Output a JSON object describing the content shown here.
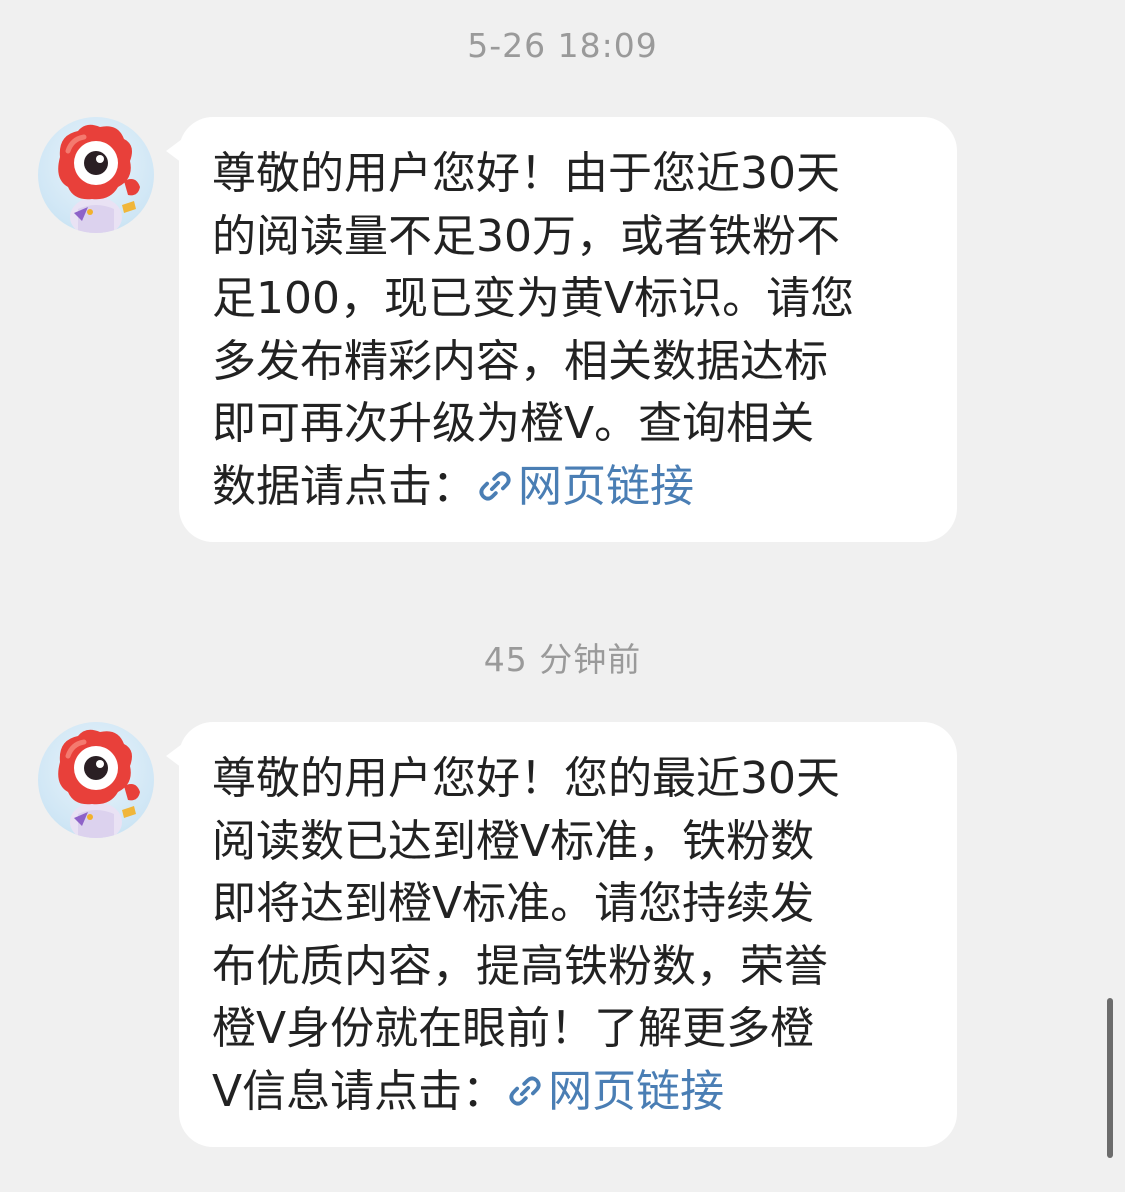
{
  "messages": [
    {
      "timestamp": "5-26 18:09",
      "text": "尊敬的用户您好！由于您近30天\n的阅读量不足30万，或者铁粉不\n足100，现已变为黄V标识。请您\n多发布精彩内容，相关数据达标\n即可再次升级为橙V。查询相关\n数据请点击：",
      "link_label": "网页链接",
      "link_icon": "link-icon",
      "avatar_icon": "weibo-mascot-avatar"
    },
    {
      "timestamp": "45 分钟前",
      "text": "尊敬的用户您好！您的最近30天\n阅读数已达到橙V标准，铁粉数\n即将达到橙V标准。请您持续发\n布优质内容，提高铁粉数，荣誉\n橙V身份就在眼前！了解更多橙\nV信息请点击：",
      "link_label": "网页链接",
      "link_icon": "link-icon",
      "avatar_icon": "weibo-mascot-avatar"
    }
  ],
  "colors": {
    "background": "#f0f0f0",
    "bubble": "#ffffff",
    "text": "#222222",
    "link": "#4a7eb4",
    "timestamp": "#9a9a9a"
  }
}
